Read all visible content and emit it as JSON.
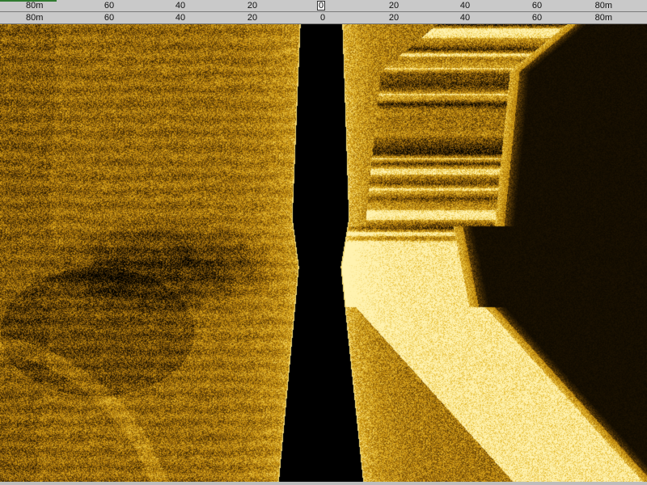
{
  "range_scale": {
    "top_labels": [
      "80m",
      "60",
      "40",
      "20",
      "0",
      "20",
      "40",
      "60",
      "80m"
    ],
    "bottom_labels": [
      "80m",
      "60",
      "40",
      "20",
      "0",
      "20",
      "40",
      "60",
      "80m"
    ],
    "max_range_m": 80,
    "center_marker": "0"
  },
  "sonar_view": {
    "palette": [
      "#000000",
      "#3a2604",
      "#8a5d0c",
      "#c9920f",
      "#e8c13a",
      "#fff2b0"
    ],
    "water_column_color": "#000000"
  }
}
